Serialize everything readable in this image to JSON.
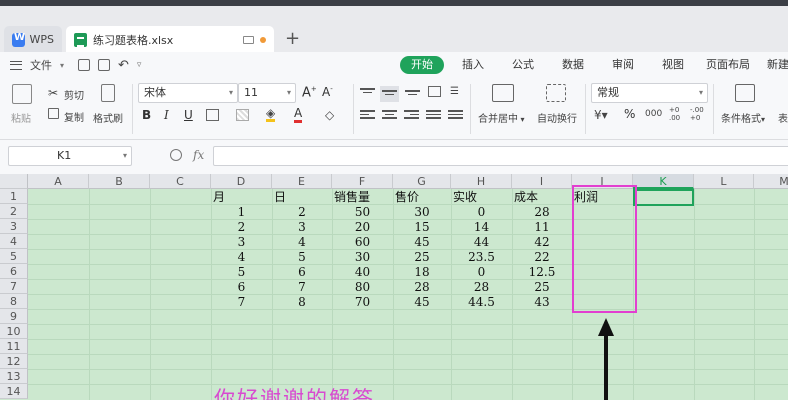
{
  "tabs": {
    "app_label": "WPS",
    "file_label": "练习题表格.xlsx",
    "new_tab": "+"
  },
  "menubar": {
    "file_menu": "文件",
    "tabs": [
      "开始",
      "插入",
      "公式",
      "数据",
      "审阅",
      "视图",
      "页面布局",
      "新建"
    ],
    "active_tab": "开始",
    "accent_color": "#1fa35b"
  },
  "ribbon": {
    "paste": "粘贴",
    "cut": "剪切",
    "copy": "复制",
    "format_painter": "格式刷",
    "font_name": "宋体",
    "font_size": "11",
    "merge_center": "合并居中",
    "wrap_text": "自动换行",
    "number_format": "常规",
    "conditional_format": "条件格式",
    "table_style_partial": "表",
    "bold": "B",
    "italic": "I",
    "underline": "U",
    "percent": "%",
    "thousands": "000",
    "dec_inc": "+0 .00",
    "dec_dec": "-.00 +0"
  },
  "formula_bar": {
    "cell_ref": "K1",
    "fx": "fx",
    "value": ""
  },
  "sheet": {
    "columns": [
      "A",
      "B",
      "C",
      "D",
      "E",
      "F",
      "G",
      "H",
      "I",
      "J",
      "K",
      "L",
      "M"
    ],
    "selected_column": "K",
    "rows": [
      "1",
      "2",
      "3",
      "4",
      "5",
      "6",
      "7",
      "8",
      "9",
      "10",
      "11",
      "12",
      "13",
      "14"
    ],
    "headers": {
      "D": "月",
      "E": "日",
      "F": "销售量",
      "G": "售价",
      "H": "实收",
      "I": "成本",
      "J": "利润"
    },
    "data": [
      {
        "D": "1",
        "E": "2",
        "F": "50",
        "G": "30",
        "H": "0",
        "I": "28"
      },
      {
        "D": "2",
        "E": "3",
        "F": "20",
        "G": "15",
        "H": "14",
        "I": "11"
      },
      {
        "D": "3",
        "E": "4",
        "F": "60",
        "G": "45",
        "H": "44",
        "I": "42"
      },
      {
        "D": "4",
        "E": "5",
        "F": "30",
        "G": "25",
        "H": "23.5",
        "I": "22"
      },
      {
        "D": "5",
        "E": "6",
        "F": "40",
        "G": "18",
        "H": "0",
        "I": "12.5"
      },
      {
        "D": "6",
        "E": "7",
        "F": "80",
        "G": "28",
        "H": "28",
        "I": "25"
      },
      {
        "D": "7",
        "E": "8",
        "F": "70",
        "G": "45",
        "H": "44.5",
        "I": "43"
      }
    ]
  },
  "annotation": {
    "note_text": "你好谢谢的解答",
    "color": "#e23fd0"
  }
}
